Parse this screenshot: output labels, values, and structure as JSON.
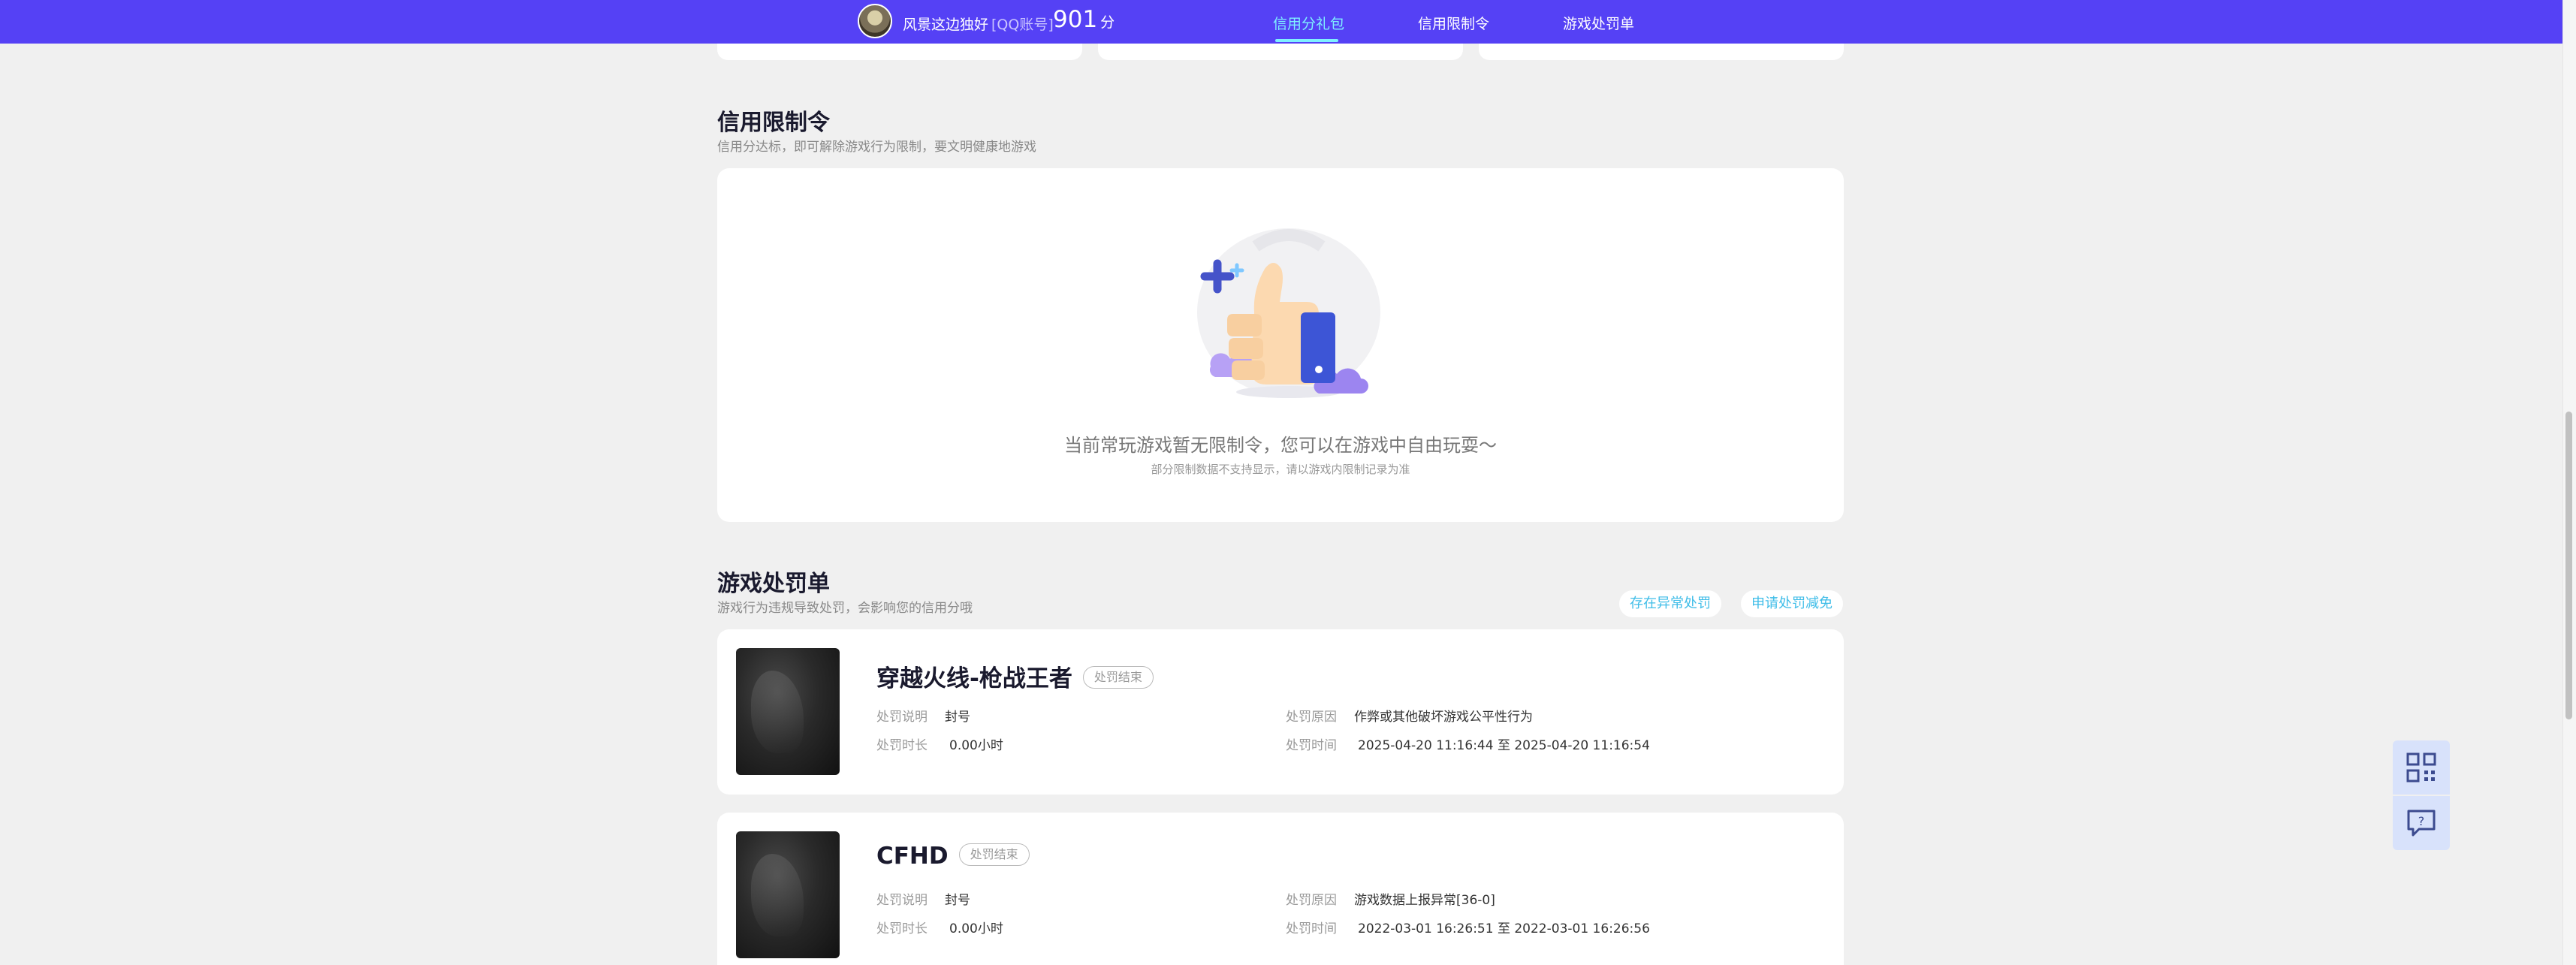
{
  "header": {
    "username": "风景这边独好",
    "account_tag": "[QQ账号]",
    "score": "901",
    "score_unit": "分",
    "nav": [
      {
        "label": "信用分礼包",
        "active": true
      },
      {
        "label": "信用限制令",
        "active": false
      },
      {
        "label": "游戏处罚单",
        "active": false
      }
    ]
  },
  "restriction": {
    "title": "信用限制令",
    "subtitle": "信用分达标，即可解除游戏行为限制，要文明健康地游戏",
    "empty_message": "当前常玩游戏暂无限制令，您可以在游戏中自由玩耍～",
    "empty_note": "部分限制数据不支持显示，请以游戏内限制记录为准",
    "illustration": "thumbs-up-icon"
  },
  "punishment": {
    "title": "游戏处罚单",
    "subtitle": "游戏行为违规导致处罚，会影响您的信用分哦",
    "actions": [
      "存在异常处罚",
      "申请处罚减免"
    ],
    "labels": {
      "desc": "处罚说明",
      "duration": "处罚时长",
      "reason": "处罚原因",
      "time": "处罚时间"
    },
    "items": [
      {
        "game": "穿越火线-枪战王者",
        "status": "处罚结束",
        "desc": "封号",
        "duration": "0.00小时",
        "reason": "作弊或其他破坏游戏公平性行为",
        "time": "2025-04-20 11:16:44 至 2025-04-20 11:16:54"
      },
      {
        "game": "CFHD",
        "status": "处罚结束",
        "desc": "封号",
        "duration": "0.00小时",
        "reason": "游戏数据上报异常[36-0]",
        "time": "2022-03-01 16:26:51 至 2022-03-01 16:26:56"
      }
    ]
  },
  "float_buttons": [
    "qrcode-icon",
    "feedback-icon"
  ],
  "colors": {
    "header_bg": "#5541f5",
    "nav_active": "#7ff0ff",
    "accent_link": "#3fbde8",
    "page_bg": "#f0f0f0"
  }
}
